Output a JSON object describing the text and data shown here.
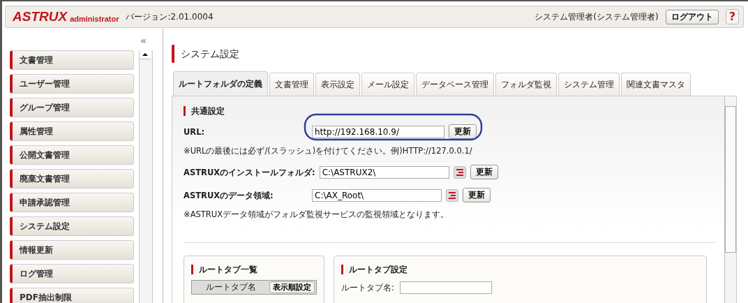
{
  "header": {
    "logo": "ASTRUX",
    "logo_sub": "administrator",
    "version": "バージョン:2.01.0004",
    "user": "システム管理者(システム管理者)",
    "logout": "ログアウト",
    "help": "?"
  },
  "sidebar": {
    "collapse": "«",
    "items": [
      {
        "label": "文書管理"
      },
      {
        "label": "ユーザー管理"
      },
      {
        "label": "グループ管理"
      },
      {
        "label": "属性管理"
      },
      {
        "label": "公開文書管理"
      },
      {
        "label": "廃棄文書管理"
      },
      {
        "label": "申請承認管理"
      },
      {
        "label": "システム設定"
      },
      {
        "label": "情報更新"
      },
      {
        "label": "ログ管理"
      },
      {
        "label": "PDF抽出制限"
      }
    ]
  },
  "page_title": "システム設定",
  "tabs": [
    {
      "label": "ルートフォルダの定義",
      "selected": true
    },
    {
      "label": "文書管理",
      "selected": false
    },
    {
      "label": "表示設定",
      "selected": false
    },
    {
      "label": "メール設定",
      "selected": false
    },
    {
      "label": "データベース管理",
      "selected": false
    },
    {
      "label": "フォルダ監視",
      "selected": false
    },
    {
      "label": "システム管理",
      "selected": false
    },
    {
      "label": "関連文書マスタ",
      "selected": false
    }
  ],
  "common": {
    "heading": "共通設定",
    "url": {
      "label": "URL:",
      "value": "http://192.168.10.9/",
      "button": "更新"
    },
    "url_note": "※URLの最後には必ず/(スラッシュ)を付けてください。例)HTTP://127.0.0.1/",
    "folders": [
      {
        "label": "ASTRUXのインストールフォルダ:",
        "value": "C:\\ASTRUX2\\",
        "button": "更新"
      },
      {
        "label": "ASTRUXのデータ領域:",
        "value": "C:\\AX_Root\\",
        "button": "更新"
      }
    ],
    "folder_note": "※ASTRUXデータ領域がフォルダ監視サービスの監視領域となります。"
  },
  "root_tab_list": {
    "heading": "ルートタブ一覧",
    "column": "ルートタブ名",
    "sort_button": "表示順設定"
  },
  "root_tab_settings": {
    "heading": "ルートタブ設定",
    "name_label": "ルートタブ名:"
  }
}
